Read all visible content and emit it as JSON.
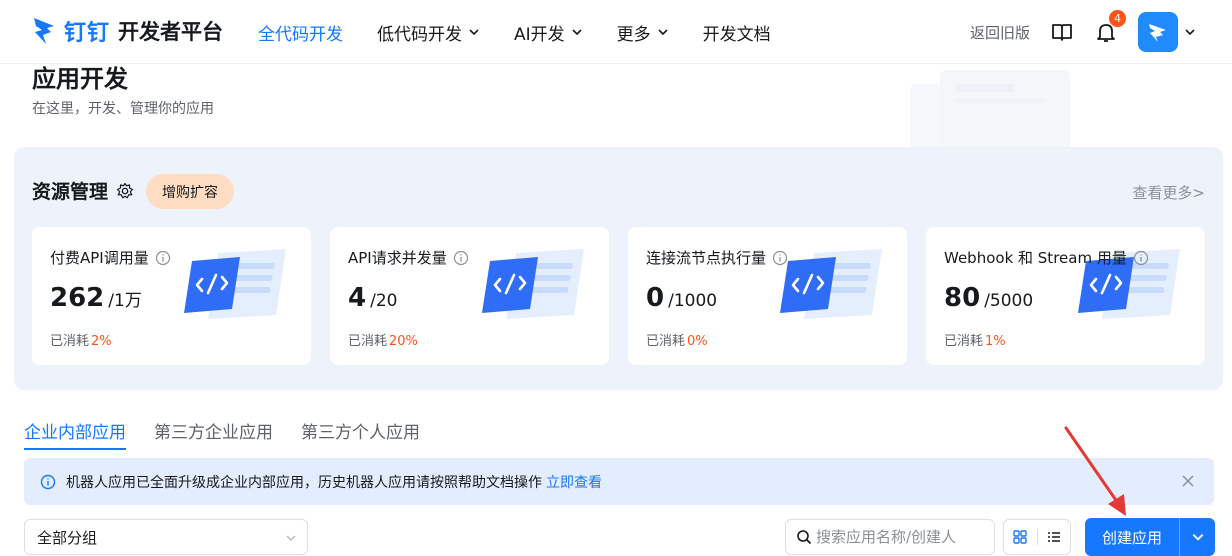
{
  "nav": {
    "brand_name": "钉钉",
    "brand_sub": "开发者平台",
    "items": [
      {
        "label": "全代码开发",
        "active": true,
        "dropdown": false
      },
      {
        "label": "低代码开发",
        "active": false,
        "dropdown": true
      },
      {
        "label": "AI开发",
        "active": false,
        "dropdown": true
      },
      {
        "label": "更多",
        "active": false,
        "dropdown": true
      },
      {
        "label": "开发文档",
        "active": false,
        "dropdown": false
      }
    ],
    "old_version": "返回旧版",
    "notification_count": "4"
  },
  "header": {
    "title": "应用开发",
    "subtitle": "在这里，开发、管理你的应用"
  },
  "resource": {
    "title": "资源管理",
    "buy_label": "增购扩容",
    "see_more": "查看更多>",
    "used_prefix": "已消耗",
    "cards": [
      {
        "title": "付费API调用量",
        "value": "262",
        "total": "/1万",
        "used": "2%"
      },
      {
        "title": "API请求并发量",
        "value": "4",
        "total": "/20",
        "used": "20%"
      },
      {
        "title": "连接流节点执行量",
        "value": "0",
        "total": "/1000",
        "used": "0%"
      },
      {
        "title": "Webhook 和 Stream 用量",
        "value": "80",
        "total": "/5000",
        "used": "1%"
      }
    ]
  },
  "tabs": [
    {
      "label": "企业内部应用",
      "active": true
    },
    {
      "label": "第三方企业应用",
      "active": false
    },
    {
      "label": "第三方个人应用",
      "active": false
    }
  ],
  "notice": {
    "text": "机器人应用已全面升级成企业内部应用，历史机器人应用请按照帮助文档操作",
    "link": "立即查看"
  },
  "controls": {
    "group_select": "全部分组",
    "search_placeholder": "搜索应用名称/创建人",
    "create_label": "创建应用"
  },
  "colors": {
    "accent": "#1677ff",
    "warning": "#ff5219",
    "panel_bg": "#eef3fb",
    "notice_bg": "#e3edfd",
    "buy_bg": "#ffdcc2",
    "annotation": "#e53935"
  }
}
